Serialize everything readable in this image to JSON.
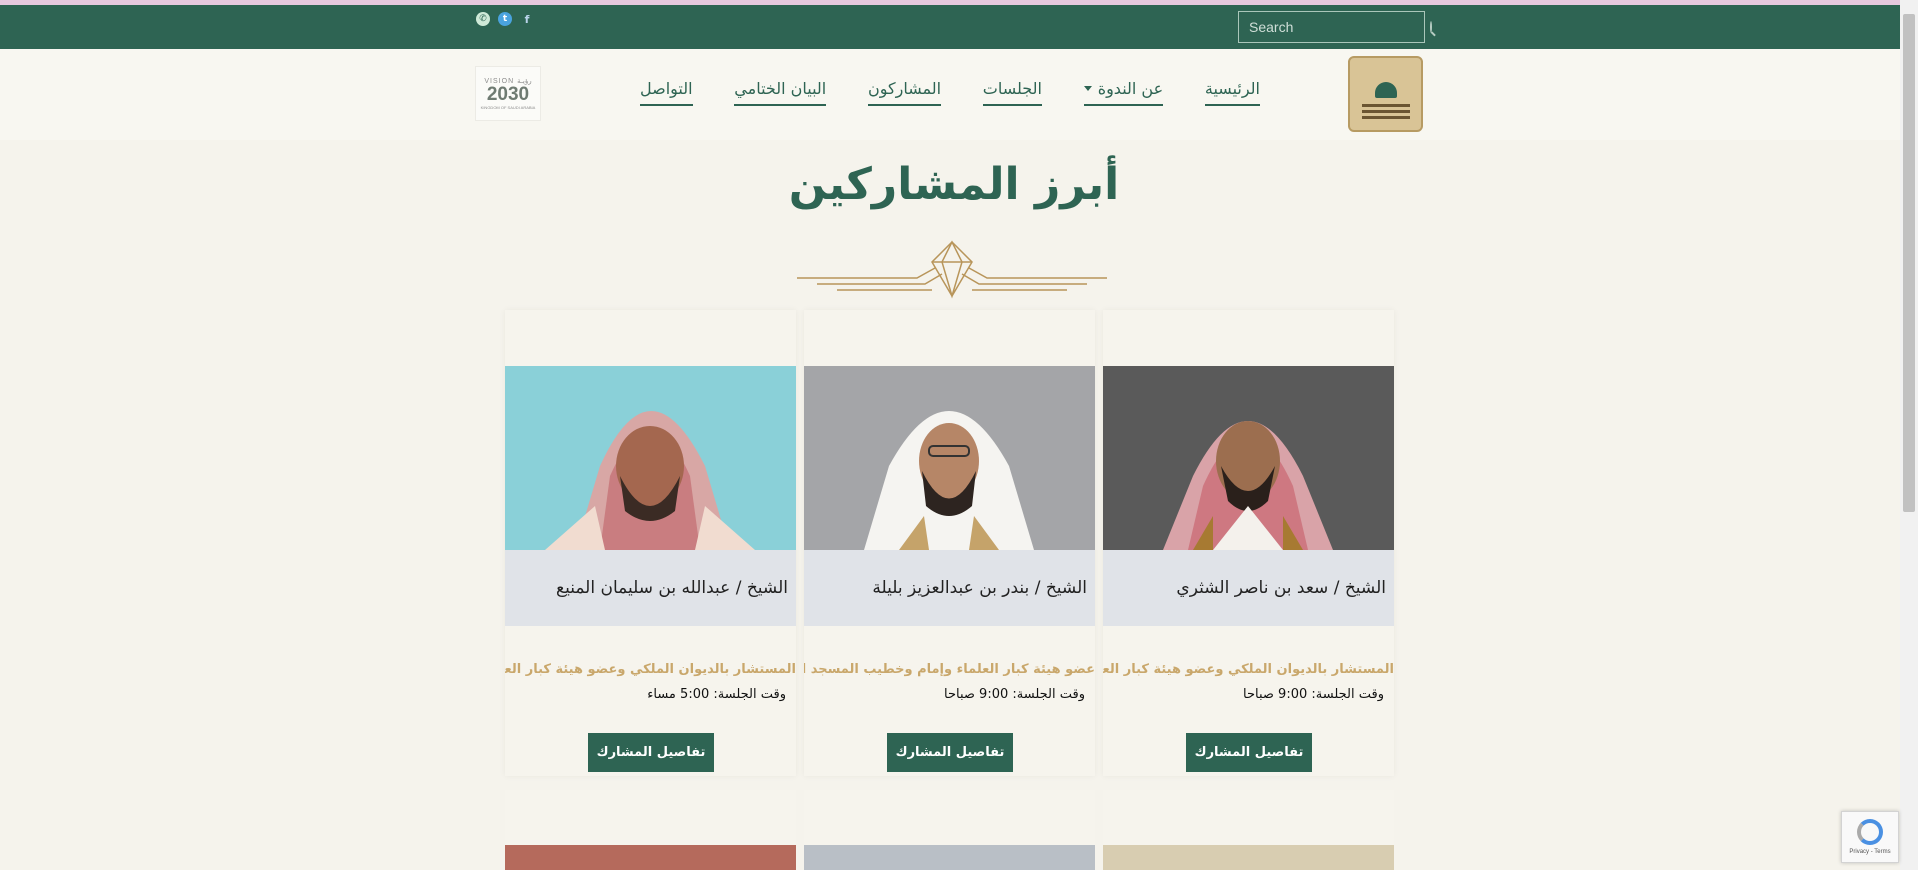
{
  "search": {
    "placeholder": "Search"
  },
  "nav": {
    "items": [
      {
        "label": "الرئيسية"
      },
      {
        "label": "عن الندوة"
      },
      {
        "label": "الجلسات"
      },
      {
        "label": "المشاركون"
      },
      {
        "label": "البيان الختامي"
      },
      {
        "label": "التواصل"
      }
    ]
  },
  "vision": {
    "line1": "VISION رؤيـة",
    "line2": "2030"
  },
  "section": {
    "title": "أبرز المشاركين"
  },
  "participants": [
    {
      "name": "الشيخ / سعد بن ناصر الشثري",
      "role": "المستشار بالديوان الملكي وعضو هيئة كبار العلماء",
      "time": "وقت الجلسة: 9:00 صباحا",
      "button": "تفاصيل المشارك"
    },
    {
      "name": "الشيخ / بندر بن عبدالعزيز بليلة",
      "role": "عضو هيئة كبار العلماء وإمام وخطيب المسجد الحرام",
      "time": "وقت الجلسة: 9:00 صباحا",
      "button": "تفاصيل المشارك"
    },
    {
      "name": "الشيخ / عبدالله بن سليمان المنيع",
      "role": "المستشار بالديوان الملكي وعضو هيئة كبار العلماء",
      "time": "وقت الجلسة: 5:00 مساء",
      "button": "تفاصيل المشارك"
    }
  ],
  "recaptcha": {
    "text": "Privacy - Terms"
  }
}
